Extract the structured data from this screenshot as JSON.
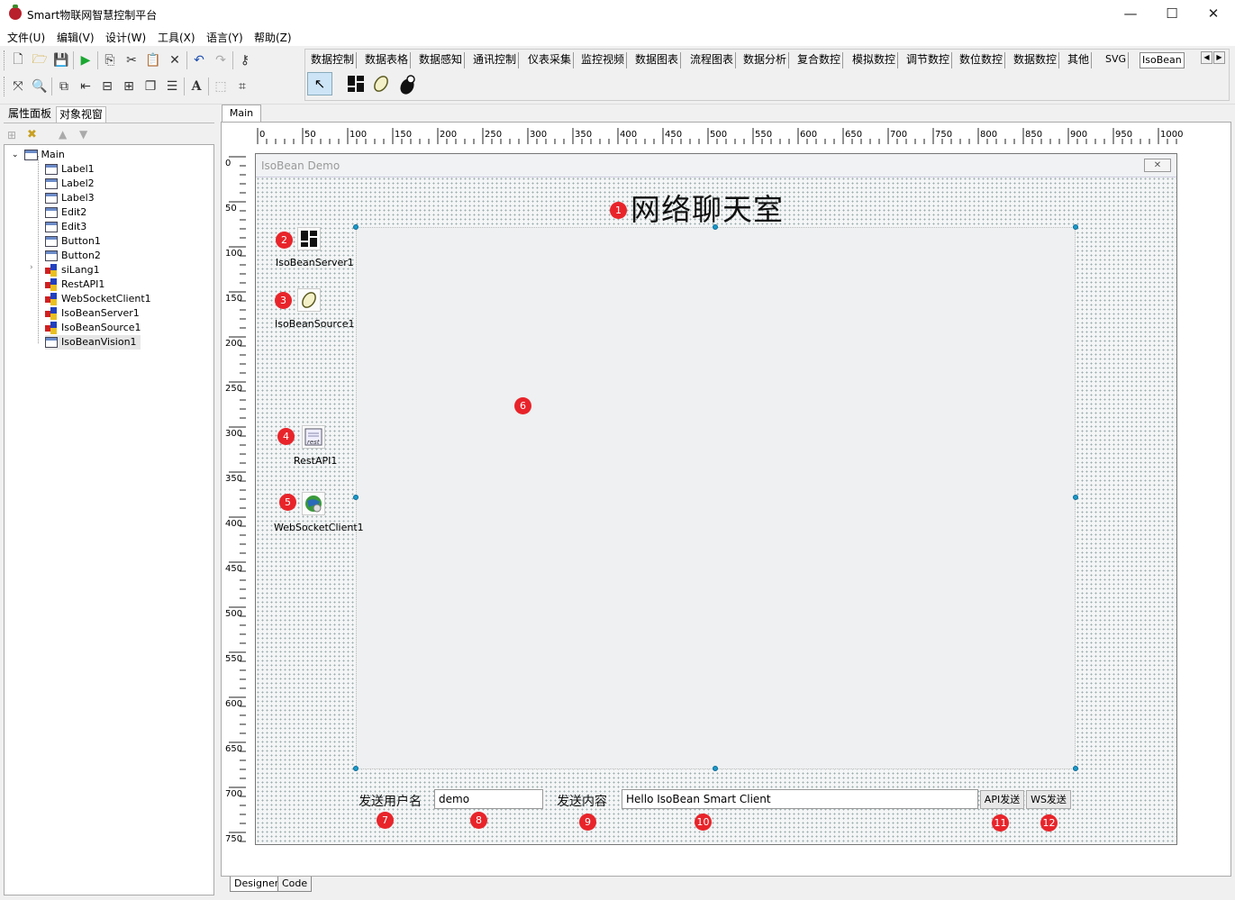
{
  "window": {
    "title": "Smart物联网智慧控制平台",
    "minimize": "—",
    "maximize": "☐",
    "close": "✕"
  },
  "menu": [
    "文件(U)",
    "编辑(V)",
    "设计(W)",
    "工具(X)",
    "语言(Y)",
    "帮助(Z)"
  ],
  "component_tabs": [
    "数据控制",
    "数据表格",
    "数据感知",
    "通讯控制",
    "仪表采集",
    "监控视频",
    "数据图表",
    "流程图表",
    "数据分析",
    "复合数控",
    "模拟数控",
    "调节数控",
    "数位数控",
    "数据数控",
    "其他",
    "SVG",
    "IsoBean"
  ],
  "left_panel": {
    "tabs": [
      "属性面板",
      "对象视窗"
    ],
    "tree_root": "Main",
    "tree_items": [
      "Label1",
      "Label2",
      "Label3",
      "Edit2",
      "Edit3",
      "Button1",
      "Button2",
      "siLang1",
      "RestAPI1",
      "WebSocketClient1",
      "IsoBeanServer1",
      "IsoBeanSource1",
      "IsoBeanVision1"
    ]
  },
  "designer": {
    "tab": "Main",
    "ruler_h": [
      "0",
      "50",
      "100",
      "150",
      "200",
      "250",
      "300",
      "350",
      "400",
      "450",
      "500",
      "550",
      "600",
      "650",
      "700",
      "750",
      "800",
      "850",
      "900",
      "950",
      "1000"
    ],
    "ruler_v": [
      "0",
      "50",
      "100",
      "150",
      "200",
      "250",
      "300",
      "350",
      "400",
      "450",
      "500",
      "550",
      "600",
      "650",
      "700",
      "750"
    ],
    "bottom_tabs": [
      "Designer",
      "Code"
    ]
  },
  "form": {
    "title": "IsoBean Demo",
    "chat_title": "网络聊天室",
    "components": [
      "IsoBeanServer1",
      "IsoBeanSource1",
      "RestAPI1",
      "WebSocketClient1"
    ],
    "username_label": "发送用户名",
    "username_value": "demo",
    "content_label": "发送内容",
    "content_value": "Hello IsoBean Smart Client",
    "api_button": "API发送",
    "ws_button": "WS发送"
  },
  "badges": [
    "1",
    "2",
    "3",
    "4",
    "5",
    "6",
    "7",
    "8",
    "9",
    "10",
    "11",
    "12"
  ],
  "colors": {
    "badge": "#e8242a",
    "handle": "#1a9ac8",
    "play": "#1aa832"
  }
}
